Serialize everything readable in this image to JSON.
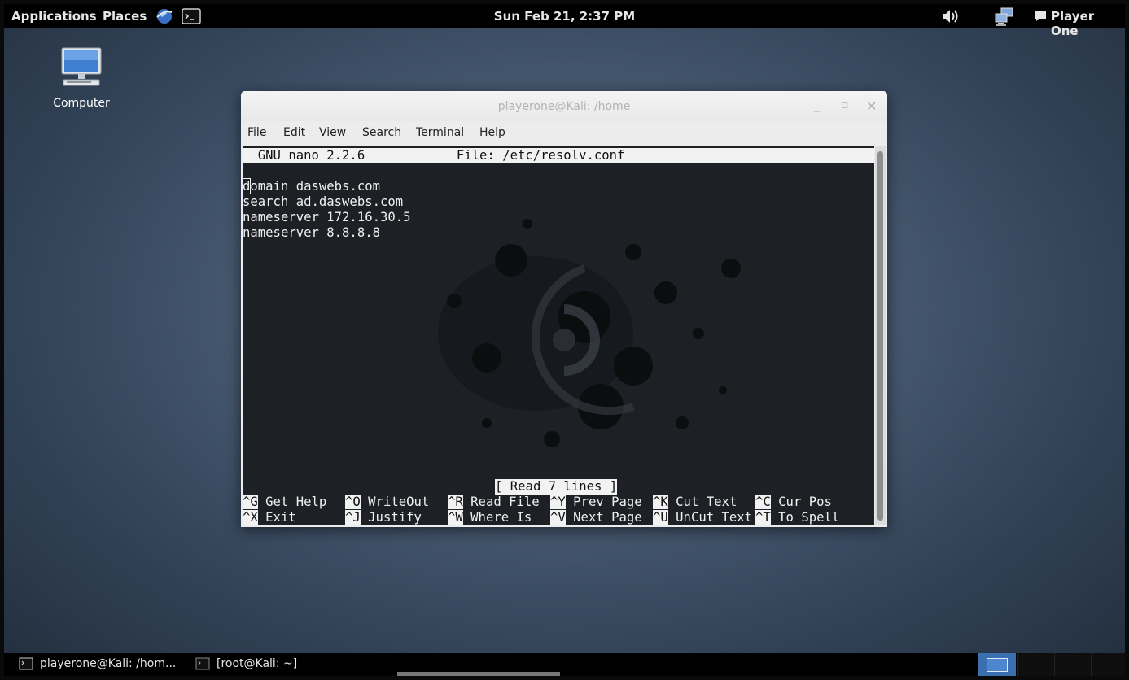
{
  "top_panel": {
    "applications": "Applications",
    "places": "Places",
    "clock": "Sun Feb 21,  2:37 PM",
    "user": "Player One"
  },
  "desktop": {
    "computer_label": "Computer"
  },
  "window": {
    "title": "playerone@Kali: /home",
    "menu": [
      "File",
      "Edit",
      "View",
      "Search",
      "Terminal",
      "Help"
    ]
  },
  "nano": {
    "header": "  GNU nano 2.2.6            File: /etc/resolv.conf",
    "lines": [
      "domain daswebs.com",
      "search ad.daswebs.com",
      "nameserver 172.16.30.5",
      "nameserver 8.8.8.8"
    ],
    "cursor_char": "d",
    "status": "[ Read 7 lines ]",
    "shortcuts": [
      [
        {
          "key": "^G",
          "label": " Get Help"
        },
        {
          "key": "^O",
          "label": " WriteOut"
        },
        {
          "key": "^R",
          "label": " Read File"
        },
        {
          "key": "^Y",
          "label": " Prev Page"
        },
        {
          "key": "^K",
          "label": " Cut Text"
        },
        {
          "key": "^C",
          "label": " Cur Pos"
        }
      ],
      [
        {
          "key": "^X",
          "label": " Exit"
        },
        {
          "key": "^J",
          "label": " Justify"
        },
        {
          "key": "^W",
          "label": " Where Is"
        },
        {
          "key": "^V",
          "label": " Next Page"
        },
        {
          "key": "^U",
          "label": " UnCut Text"
        },
        {
          "key": "^T",
          "label": " To Spell"
        }
      ]
    ]
  },
  "taskbar": {
    "tasks": [
      "playerone@Kali: /hom...",
      "[root@Kali: ~]"
    ]
  }
}
